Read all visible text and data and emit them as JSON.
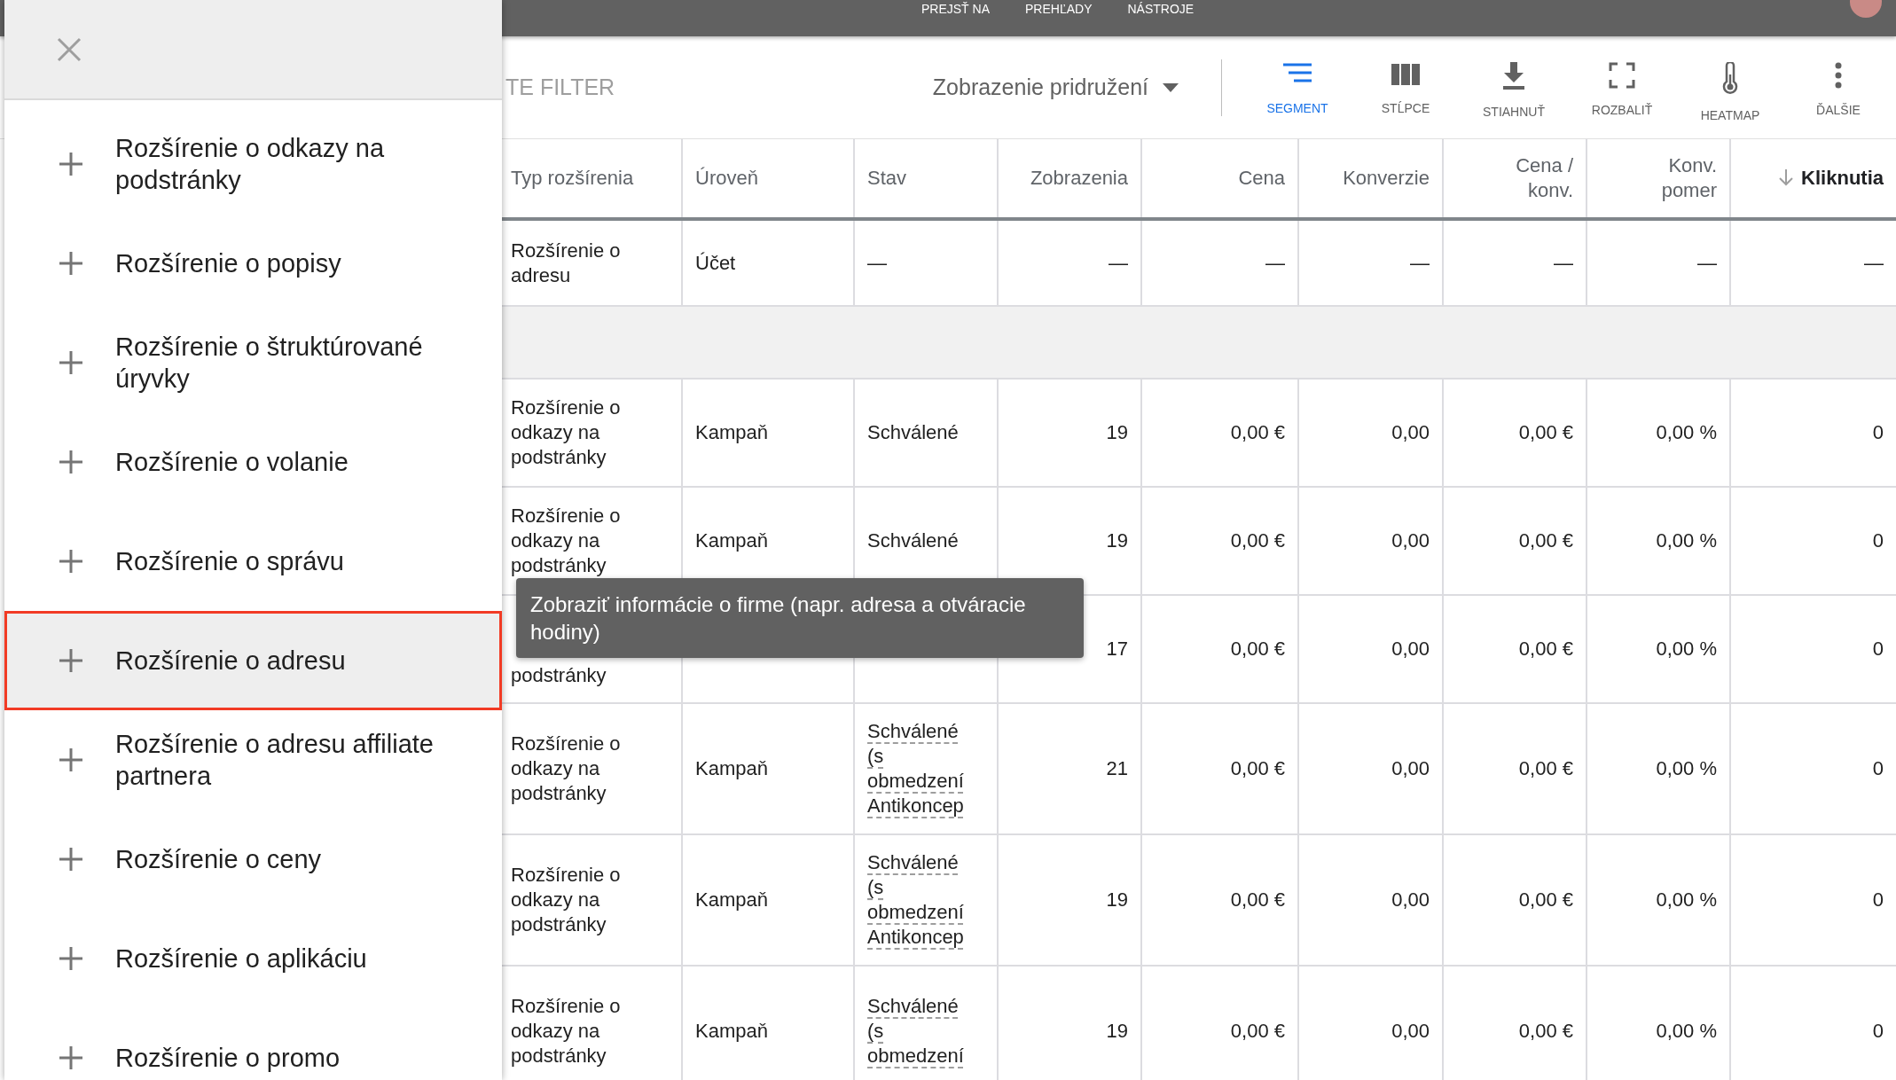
{
  "top_nav": [
    "PREJSŤ NA",
    "PREHĽADY",
    "NÁSTROJE"
  ],
  "toolbar": {
    "filter_label": "TE FILTER",
    "view_dropdown": "Zobrazenie pridružení",
    "buttons": [
      {
        "kind": "segment",
        "label": "SEGMENT",
        "selected": true
      },
      {
        "kind": "columns",
        "label": "STĹPCE",
        "selected": false
      },
      {
        "kind": "download",
        "label": "STIAHNUŤ",
        "selected": false
      },
      {
        "kind": "expand",
        "label": "ROZBALIŤ",
        "selected": false
      },
      {
        "kind": "heatmap",
        "label": "HEATMAP",
        "selected": false
      },
      {
        "kind": "more",
        "label": "ĎALŠIE",
        "selected": false
      }
    ]
  },
  "table": {
    "columns": [
      {
        "label": "Typ rozšírenia",
        "sorted": false
      },
      {
        "label": "Úroveň",
        "sorted": false
      },
      {
        "label": "Stav",
        "sorted": false
      },
      {
        "label": "Zobrazenia",
        "sorted": false
      },
      {
        "label": "Cena",
        "sorted": false
      },
      {
        "label": "Konverzie",
        "sorted": false
      },
      {
        "label": "Cena / konv.",
        "sorted": false
      },
      {
        "label": "Konv. pomer",
        "sorted": false
      },
      {
        "label": "Kliknutia",
        "sorted": true
      }
    ],
    "rows": [
      {
        "kind": "data",
        "status_details": false,
        "cells": [
          "Rozšírenie o adresu",
          "Účet",
          "—",
          "—",
          "—",
          "—",
          "—",
          "—",
          "—"
        ]
      },
      {
        "kind": "group"
      },
      {
        "kind": "data",
        "status_details": false,
        "cells": [
          "Rozšírenie o odkazy na podstránky",
          "Kampaň",
          "Schválené",
          "19",
          "0,00 €",
          "0,00",
          "0,00 €",
          "0,00 %",
          "0"
        ]
      },
      {
        "kind": "data",
        "status_details": false,
        "cells": [
          "Rozšírenie o odkazy na podstránky",
          "Kampaň",
          "Schválené",
          "19",
          "0,00 €",
          "0,00",
          "0,00 €",
          "0,00 %",
          "0"
        ]
      },
      {
        "kind": "data",
        "status_details": false,
        "cells": [
          "podstránky",
          null,
          null,
          "17",
          "0,00 €",
          "0,00",
          "0,00 €",
          "0,00 %",
          "0"
        ]
      },
      {
        "kind": "data",
        "status_details": true,
        "cells": [
          "Rozšírenie o odkazy na podstránky",
          "Kampaň",
          "Schválené (s obmedzení Antikoncep",
          "21",
          "0,00 €",
          "0,00",
          "0,00 €",
          "0,00 %",
          "0"
        ]
      },
      {
        "kind": "data",
        "status_details": true,
        "cells": [
          "Rozšírenie o odkazy na podstránky",
          "Kampaň",
          "Schválené (s obmedzení Antikoncep",
          "19",
          "0,00 €",
          "0,00",
          "0,00 €",
          "0,00 %",
          "0"
        ]
      },
      {
        "kind": "data",
        "status_details": true,
        "cells": [
          "Rozšírenie o odkazy na podstránky",
          "Kampaň",
          "Schválené (s obmedzení",
          "19",
          "0,00 €",
          "0,00",
          "0,00 €",
          "0,00 %",
          "0"
        ]
      }
    ]
  },
  "panel": {
    "items": [
      {
        "label": "Rozšírenie o odkazy na podstránky",
        "selected": false
      },
      {
        "label": "Rozšírenie o popisy",
        "selected": false
      },
      {
        "label": "Rozšírenie o štruktúrované úryvky",
        "selected": false
      },
      {
        "label": "Rozšírenie o volanie",
        "selected": false
      },
      {
        "label": "Rozšírenie o správu",
        "selected": false
      },
      {
        "label": "Rozšírenie o adresu",
        "selected": true
      },
      {
        "label": "Rozšírenie o adresu affiliate partnera",
        "selected": false
      },
      {
        "label": "Rozšírenie o ceny",
        "selected": false
      },
      {
        "label": "Rozšírenie o aplikáciu",
        "selected": false
      },
      {
        "label": "Rozšírenie o promo",
        "selected": false
      }
    ]
  },
  "tooltip": {
    "text": "Zobraziť informácie o firme (napr. adresa a otváracie hodiny)"
  }
}
